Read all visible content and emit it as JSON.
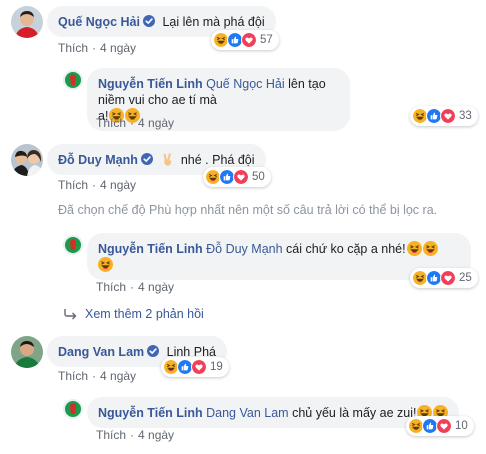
{
  "comments": [
    {
      "author": "Quế Ngọc Hải",
      "text": "Lại lên mà phá đội",
      "like": "Thích",
      "time": "4 ngày",
      "reaction_count": "57"
    },
    {
      "author": "Nguyễn Tiến Linh",
      "mention": "Quế Ngọc Hải",
      "text_line1": "lên tạo niềm vui cho ae tí mà",
      "text_line2": "a!",
      "like": "Thích",
      "time": "4 ngày",
      "reaction_count": "33"
    },
    {
      "author": "Đỗ Duy Mạnh",
      "text": "nhé . Phá đội",
      "like": "Thích",
      "time": "4 ngày",
      "reaction_count": "50"
    },
    {
      "author": "Nguyễn Tiến Linh",
      "mention": "Đỗ Duy Mạnh",
      "text": "cái chứ ko cặp a nhé!",
      "like": "Thích",
      "time": "4 ngày",
      "reaction_count": "25"
    },
    {
      "author": "Dang Van Lam",
      "text": "Linh Phá",
      "like": "Thích",
      "time": "4 ngày",
      "reaction_count": "19"
    },
    {
      "author": "Nguyễn Tiến Linh",
      "mention": "Dang Van Lam",
      "text": "chủ yếu là mấy ae zui!",
      "like": "Thích",
      "time": "4 ngày",
      "reaction_count": "10"
    }
  ],
  "filter_note": "Đã chọn chế độ Phù hợp nhất nên một số câu trả lời có thể bị lọc ra.",
  "more_replies": "Xem thêm 2 phản hồi",
  "dot": "·",
  "colors": {
    "link": "#385898",
    "bubble": "#f2f3f5",
    "meta": "#606770",
    "like_blue": "#2078f4",
    "love_red": "#f33e58",
    "haha_yellow": "#f7b125"
  },
  "icons": {
    "verified": "verified-badge-icon",
    "like": "like-reaction-icon",
    "love": "love-reaction-icon",
    "haha": "haha-reaction-icon",
    "reply_arrow": "reply-arrow-icon",
    "victory_hand": "victory-hand-emoji"
  }
}
